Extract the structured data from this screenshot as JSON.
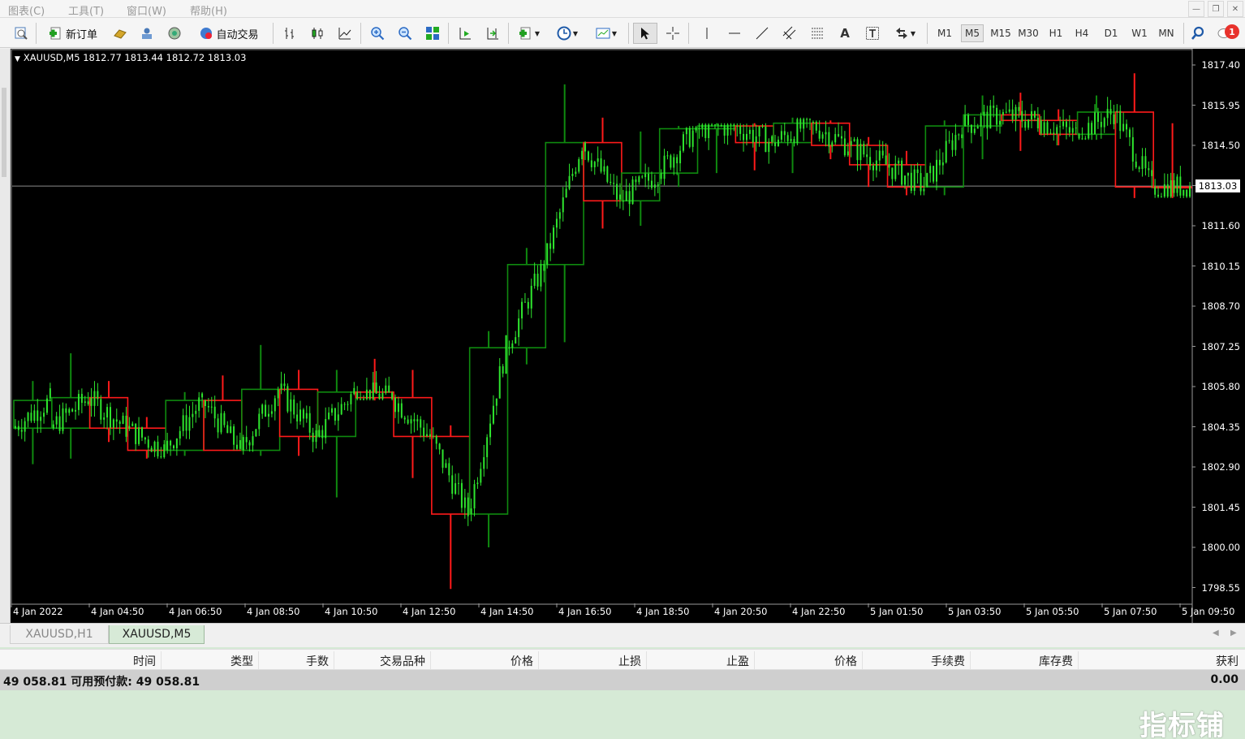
{
  "menu": [
    "图表(C)",
    "工具(T)",
    "窗口(W)",
    "帮助(H)"
  ],
  "toolbar": {
    "new_order_label": "新订单",
    "auto_trade_label": "自动交易",
    "timeframes": [
      "M1",
      "M5",
      "M15",
      "M30",
      "H1",
      "H4",
      "D1",
      "W1",
      "MN"
    ],
    "active_timeframe": "M5",
    "notification_count": "1"
  },
  "chart": {
    "header": "XAUUSD,M5  1812.77 1813.44 1812.72 1813.03",
    "current_price_label": "1813.03",
    "price_ticks": [
      "1817.40",
      "1815.95",
      "1814.50",
      "1813.05",
      "1811.60",
      "1810.15",
      "1808.70",
      "1807.25",
      "1805.80",
      "1804.35",
      "1802.90",
      "1801.45",
      "1800.00",
      "1798.55"
    ],
    "time_ticks": [
      "4 Jan 2022",
      "4 Jan 04:50",
      "4 Jan 06:50",
      "4 Jan 08:50",
      "4 Jan 10:50",
      "4 Jan 12:50",
      "4 Jan 14:50",
      "4 Jan 16:50",
      "4 Jan 18:50",
      "4 Jan 20:50",
      "4 Jan 22:50",
      "5 Jan 01:50",
      "5 Jan 03:50",
      "5 Jan 05:50",
      "5 Jan 07:50",
      "5 Jan 09:50"
    ],
    "colors": {
      "bull": "#2ee62e",
      "hbox_up": "#0f8a0f",
      "hbox_down": "#ff1a1a",
      "background": "#000000",
      "current_line": "#8a8a8a"
    }
  },
  "chart_data": {
    "type": "candlestick",
    "symbol": "XAUUSD",
    "timeframe": "M5",
    "ohlc": {
      "open": 1812.77,
      "high": 1813.44,
      "low": 1812.72,
      "close": 1813.03
    },
    "ylim": [
      1798.0,
      1817.8
    ],
    "price_ticks": [
      1817.4,
      1815.95,
      1814.5,
      1813.05,
      1811.6,
      1810.15,
      1808.7,
      1807.25,
      1805.8,
      1804.35,
      1802.9,
      1801.45,
      1800.0,
      1798.55
    ],
    "current_price": 1813.03,
    "overlay_h1_boxes": [
      {
        "dir": "up",
        "open": 1804.3,
        "close": 1805.3,
        "high": 1806.0,
        "low": 1803.0
      },
      {
        "dir": "up",
        "open": 1804.3,
        "close": 1805.4,
        "high": 1807.0,
        "low": 1803.2
      },
      {
        "dir": "down",
        "open": 1805.4,
        "close": 1804.3,
        "high": 1806.0,
        "low": 1803.8
      },
      {
        "dir": "down",
        "open": 1804.3,
        "close": 1803.5,
        "high": 1804.7,
        "low": 1803.2
      },
      {
        "dir": "up",
        "open": 1803.5,
        "close": 1805.3,
        "high": 1805.6,
        "low": 1803.3
      },
      {
        "dir": "down",
        "open": 1805.3,
        "close": 1803.5,
        "high": 1806.2,
        "low": 1803.5
      },
      {
        "dir": "up",
        "open": 1803.5,
        "close": 1805.7,
        "high": 1807.3,
        "low": 1803.3
      },
      {
        "dir": "down",
        "open": 1805.7,
        "close": 1804.0,
        "high": 1806.4,
        "low": 1803.3
      },
      {
        "dir": "up",
        "open": 1804.0,
        "close": 1805.6,
        "high": 1806.4,
        "low": 1801.8
      },
      {
        "dir": "down",
        "open": 1805.6,
        "close": 1805.4,
        "high": 1806.8,
        "low": 1805.3
      },
      {
        "dir": "down",
        "open": 1805.4,
        "close": 1804.0,
        "high": 1806.4,
        "low": 1802.5
      },
      {
        "dir": "down",
        "open": 1804.0,
        "close": 1801.2,
        "high": 1804.4,
        "low": 1798.5
      },
      {
        "dir": "up",
        "open": 1801.2,
        "close": 1807.2,
        "high": 1807.8,
        "low": 1800.0
      },
      {
        "dir": "up",
        "open": 1807.2,
        "close": 1810.2,
        "high": 1810.8,
        "low": 1806.6
      },
      {
        "dir": "up",
        "open": 1810.2,
        "close": 1814.6,
        "high": 1816.7,
        "low": 1807.4
      },
      {
        "dir": "down",
        "open": 1814.6,
        "close": 1812.5,
        "high": 1815.5,
        "low": 1811.5
      },
      {
        "dir": "up",
        "open": 1812.5,
        "close": 1813.5,
        "high": 1815.0,
        "low": 1811.6
      },
      {
        "dir": "up",
        "open": 1813.5,
        "close": 1815.1,
        "high": 1815.2,
        "low": 1813.0
      },
      {
        "dir": "up",
        "open": 1815.1,
        "close": 1815.2,
        "high": 1815.3,
        "low": 1813.5
      },
      {
        "dir": "down",
        "open": 1815.2,
        "close": 1814.6,
        "high": 1815.3,
        "low": 1813.6
      },
      {
        "dir": "up",
        "open": 1814.6,
        "close": 1815.3,
        "high": 1815.5,
        "low": 1813.5
      },
      {
        "dir": "down",
        "open": 1815.3,
        "close": 1814.5,
        "high": 1815.4,
        "low": 1814.0
      },
      {
        "dir": "down",
        "open": 1814.5,
        "close": 1813.8,
        "high": 1814.8,
        "low": 1813.0
      },
      {
        "dir": "down",
        "open": 1813.8,
        "close": 1813.0,
        "high": 1814.3,
        "low": 1812.7
      },
      {
        "dir": "up",
        "open": 1813.0,
        "close": 1815.2,
        "high": 1815.4,
        "low": 1812.7
      },
      {
        "dir": "up",
        "open": 1815.2,
        "close": 1815.6,
        "high": 1816.3,
        "low": 1814.0
      },
      {
        "dir": "down",
        "open": 1815.6,
        "close": 1815.4,
        "high": 1816.4,
        "low": 1814.3
      },
      {
        "dir": "down",
        "open": 1815.4,
        "close": 1814.9,
        "high": 1815.8,
        "low": 1814.5
      },
      {
        "dir": "up",
        "open": 1814.9,
        "close": 1815.7,
        "high": 1816.3,
        "low": 1814.7
      },
      {
        "dir": "down",
        "open": 1815.7,
        "close": 1813.0,
        "high": 1817.1,
        "low": 1812.6
      },
      {
        "dir": "down",
        "open": 1813.0,
        "close": 1813.0,
        "high": 1815.3,
        "low": 1812.6
      }
    ]
  },
  "tabs": [
    {
      "label": "XAUUSD,H1",
      "active": false
    },
    {
      "label": "XAUUSD,M5",
      "active": true
    }
  ],
  "terminal": {
    "columns": [
      "时间",
      "类型",
      "手数",
      "交易品种",
      "价格",
      "止损",
      "止盈",
      "价格",
      "手续费",
      "库存费",
      "获利"
    ],
    "balance_text": "49 058.81  可用预付款: 49 058.81",
    "profit": "0.00"
  },
  "watermark": "指标铺"
}
